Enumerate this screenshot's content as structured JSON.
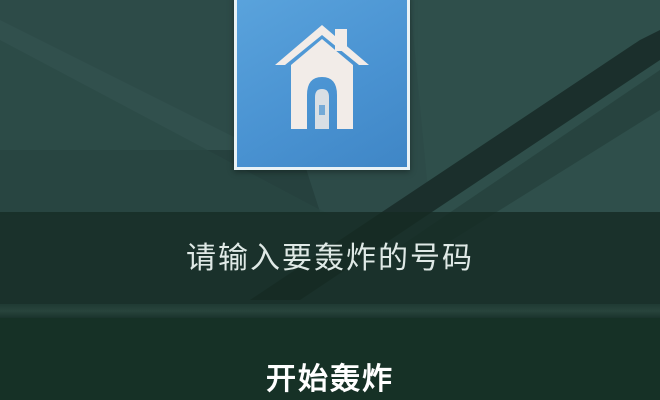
{
  "app_icon": {
    "icon": "house-icon",
    "colors": {
      "tile": "#4a93d2",
      "border": "#e9f2f6",
      "house": "#f2ece8"
    }
  },
  "phone_input": {
    "placeholder": "请输入要轰炸的号码",
    "value": ""
  },
  "start_button": {
    "label": "开始轰炸"
  },
  "colors": {
    "background": "#2c4a47",
    "input_band": "#142a22",
    "button_band": "#163126"
  }
}
